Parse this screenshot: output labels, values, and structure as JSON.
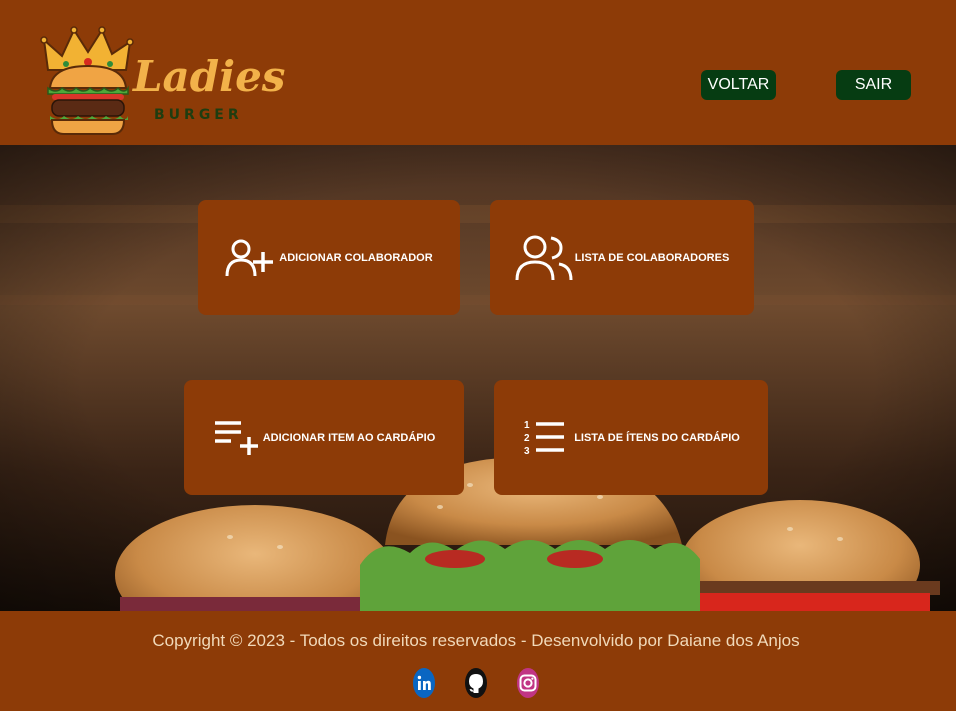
{
  "header": {
    "logo": {
      "word": "Ladies",
      "sub": "BURGER"
    },
    "buttons": {
      "back": "VOLTAR",
      "exit": "SAIR"
    }
  },
  "cards": [
    {
      "label": "ADICIONAR COLABORADOR",
      "icon": "user-plus-icon"
    },
    {
      "label": "LISTA DE COLABORADORES",
      "icon": "users-icon"
    },
    {
      "label": "ADICIONAR ITEM AO CARDÁPIO",
      "icon": "playlist-add-icon"
    },
    {
      "label": "LISTA DE ÍTENS DO CARDÁPIO",
      "icon": "ordered-list-icon"
    }
  ],
  "footer": {
    "copyright": "Copyright © 2023 - Todos os direitos reservados - Desenvolvido por Daiane dos Anjos",
    "social": [
      "linkedin-icon",
      "github-icon",
      "instagram-icon"
    ]
  },
  "colors": {
    "brand": "#8d3b07",
    "button": "#063c12",
    "logo_text": "#f2b24a"
  }
}
